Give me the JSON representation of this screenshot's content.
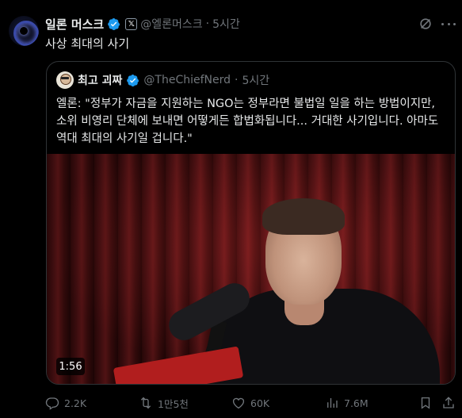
{
  "author": {
    "display_name": "일론 머스크",
    "handle": "@엘론머스크",
    "separator": "·",
    "time": "5시간",
    "x_badge": "𝕏",
    "avatar_icon": "galaxy-avatar-icon"
  },
  "tweet": {
    "text": "사상 최대의 사기"
  },
  "quote": {
    "display_name": "최고 괴짜",
    "handle": "@TheChiefNerd",
    "separator": "·",
    "time": "5시간",
    "text": "엘론: \"정부가 자금을 지원하는 NGO는 정부라면 불법일 일을 하는 방법이지만, 소위 비영리 단체에 보내면 어떻게든 합법화됩니다... 거대한 사기입니다. 아마도 역대 최대의 사기일 겁니다.\"",
    "video_duration": "1:56"
  },
  "actions": {
    "replies": "2.2K",
    "reposts": "1만5천",
    "likes": "60K",
    "views": "7.6M"
  },
  "colors": {
    "background": "#000000",
    "text": "#e7e9ea",
    "muted": "#71767b",
    "border": "#2f3336",
    "verified": "#1d9bf0"
  }
}
